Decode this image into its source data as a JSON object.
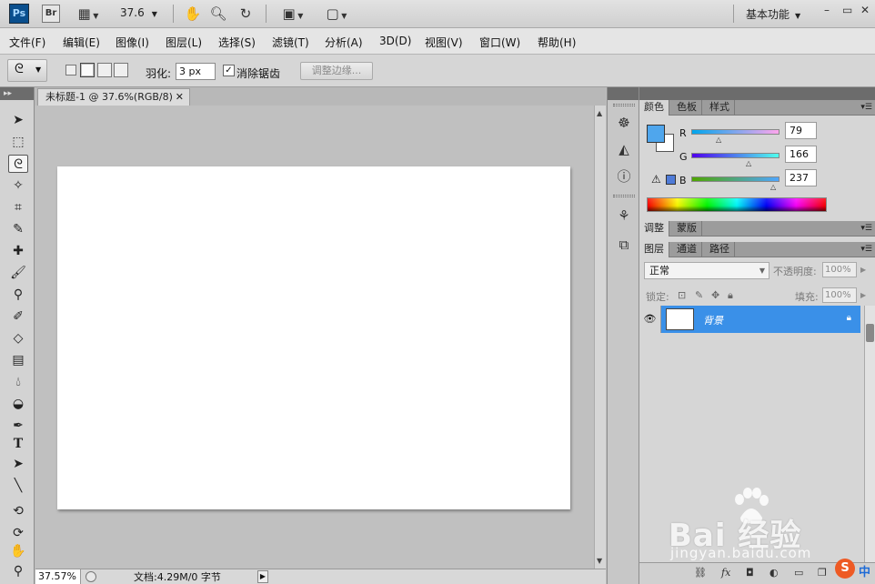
{
  "appbar": {
    "ps_logo": "Ps",
    "br_logo": "Br",
    "zoom": "37.6",
    "workspace": "基本功能"
  },
  "menu": [
    "文件(F)",
    "编辑(E)",
    "图像(I)",
    "图层(L)",
    "选择(S)",
    "滤镜(T)",
    "分析(A)",
    "3D(D)",
    "视图(V)",
    "窗口(W)",
    "帮助(H)"
  ],
  "options": {
    "feather_label": "羽化:",
    "feather_value": "3 px",
    "antialias_label": "消除锯齿",
    "antialias_checked": true,
    "refine_edge": "调整边缘..."
  },
  "document": {
    "tab_title": "未标题-1 @ 37.6%(RGB/8)",
    "status_zoom": "37.57%",
    "status_doc": "文档:4.29M/0 字节"
  },
  "color_panel": {
    "tabs": [
      "颜色",
      "色板",
      "样式"
    ],
    "channels": [
      {
        "name": "R",
        "value": "79",
        "fraction": 0.31
      },
      {
        "name": "G",
        "value": "166",
        "fraction": 0.65
      },
      {
        "name": "B",
        "value": "237",
        "fraction": 0.93
      }
    ],
    "foreground": "#4fa6ed",
    "background": "#ffffff"
  },
  "adjust_panel": {
    "tabs": [
      "调整",
      "蒙版"
    ]
  },
  "layers_panel": {
    "tabs": [
      "图层",
      "通道",
      "路径"
    ],
    "blend_mode": "正常",
    "opacity_label": "不透明度:",
    "opacity_value": "100%",
    "lock_label": "锁定:",
    "fill_label": "填充:",
    "fill_value": "100%",
    "layers": [
      {
        "name": "背景",
        "locked": true,
        "visible": true
      }
    ]
  },
  "watermark": {
    "brand": "Bai 经验",
    "url": "jingyan.baidu.com"
  },
  "ime": {
    "logo": "S",
    "mode": "中"
  }
}
